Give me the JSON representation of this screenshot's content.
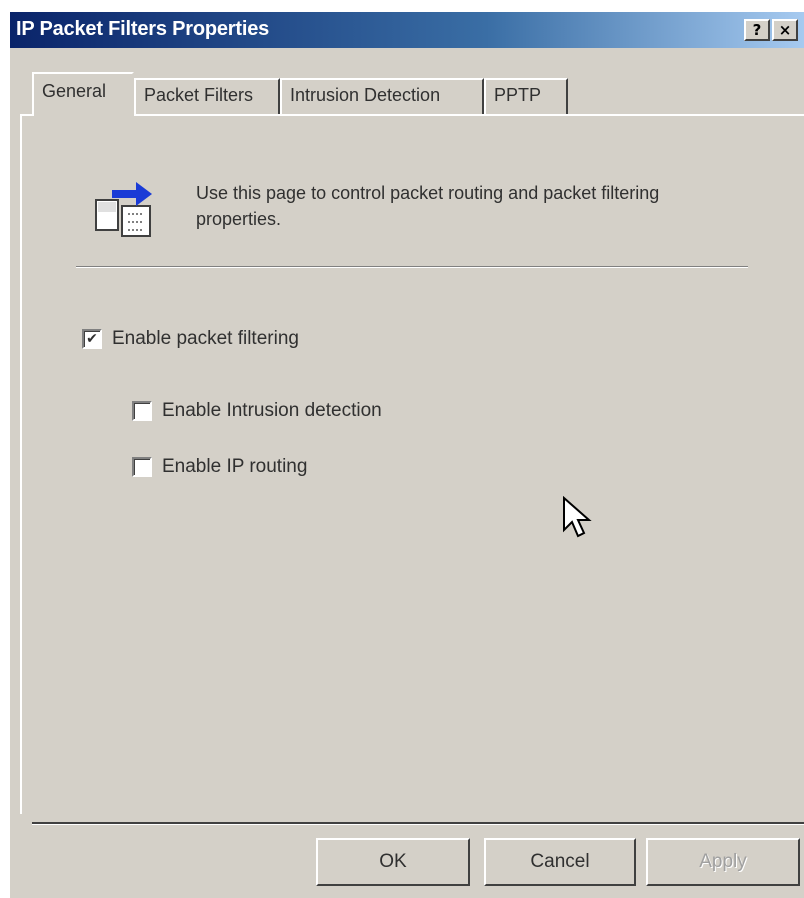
{
  "window": {
    "title": "IP Packet Filters Properties",
    "help_label": "?",
    "close_label": "×"
  },
  "tabs": [
    {
      "label": "General",
      "active": true
    },
    {
      "label": "Packet Filters",
      "active": false
    },
    {
      "label": "Intrusion Detection",
      "active": false
    },
    {
      "label": "PPTP",
      "active": false
    }
  ],
  "general": {
    "description": "Use this page to control packet routing and packet filtering properties.",
    "icon": "packet-filter-icon",
    "options": [
      {
        "label": "Enable packet filtering",
        "checked": true
      },
      {
        "label": "Enable Intrusion detection",
        "checked": false
      },
      {
        "label": "Enable IP routing",
        "checked": false
      }
    ]
  },
  "buttons": {
    "ok": "OK",
    "cancel": "Cancel",
    "apply": "Apply",
    "apply_enabled": false
  },
  "colors": {
    "titlebar_start": "#0a246a",
    "titlebar_end": "#a6caf0",
    "face": "#d4d0c8",
    "accent_arrow": "#1a3bd6"
  }
}
